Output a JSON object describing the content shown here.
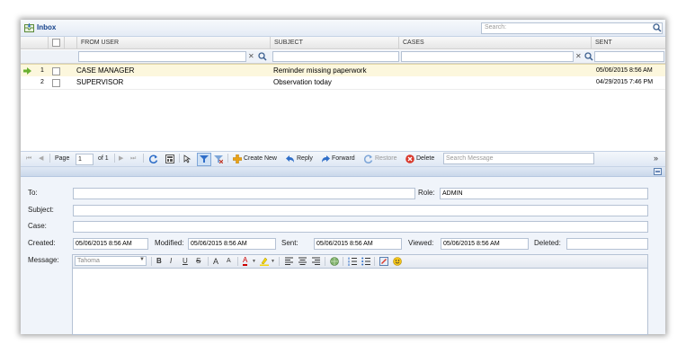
{
  "window": {
    "title": "Inbox"
  },
  "search": {
    "placeholder": "Search:"
  },
  "grid": {
    "columns": [
      "FROM USER",
      "SUBJECT",
      "CASES",
      "SENT"
    ],
    "rows": [
      {
        "num": "1",
        "from": "CASE MANAGER",
        "subject": "Reminder missing paperwork",
        "cases": "",
        "sent": "05/06/2015 8:56 AM"
      },
      {
        "num": "2",
        "from": "SUPERVISOR",
        "subject": "Observation today",
        "cases": "",
        "sent": "04/29/2015 7:46 PM"
      }
    ]
  },
  "toolbar": {
    "page_label": "Page",
    "page_value": "1",
    "of_label": "of 1",
    "create_new": "Create New",
    "reply": "Reply",
    "forward": "Forward",
    "restore": "Restore",
    "delete": "Delete",
    "search_placeholder": "Search Message",
    "more": "»"
  },
  "form": {
    "to_label": "To:",
    "to_value": "",
    "role_label": "Role:",
    "role_value": "ADMIN",
    "subject_label": "Subject:",
    "subject_value": "",
    "case_label": "Case:",
    "case_value": "",
    "created_label": "Created:",
    "created_value": "05/06/2015 8:56 AM",
    "modified_label": "Modified:",
    "modified_value": "05/06/2015 8:56 AM",
    "sent_label": "Sent:",
    "sent_value": "05/06/2015 8:56 AM",
    "viewed_label": "Viewed:",
    "viewed_value": "05/06/2015 8:56 AM",
    "deleted_label": "Deleted:",
    "deleted_value": "",
    "message_label": "Message:",
    "font_value": "Tahoma"
  },
  "editor": {
    "bold": "B",
    "italic": "I",
    "underline": "U",
    "strike": "S",
    "grow": "A",
    "shrink": "A",
    "fontcolor": "A"
  },
  "colors": {
    "accent": "#15428b",
    "selected_row": "#fcf7dd",
    "panel": "#f0f4fa"
  }
}
